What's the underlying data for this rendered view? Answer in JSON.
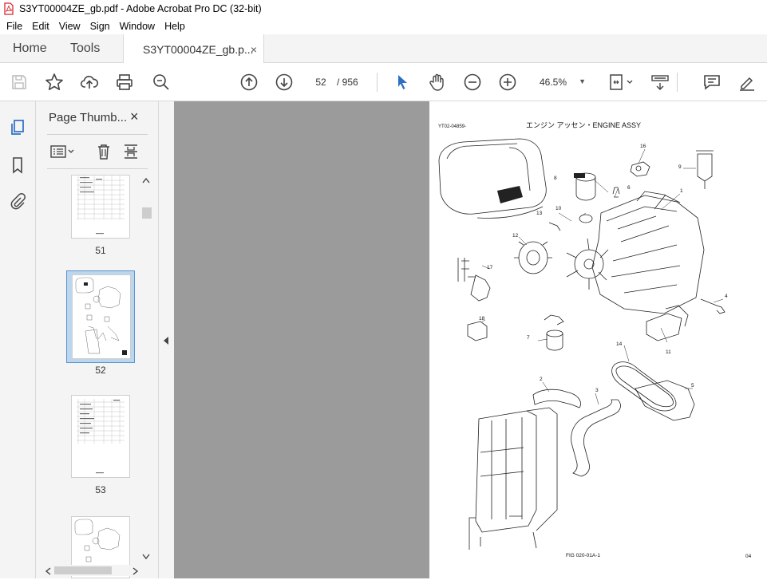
{
  "window": {
    "title": "S3YT00004ZE_gb.pdf - Adobe Acrobat Pro DC (32-bit)"
  },
  "menu": [
    "File",
    "Edit",
    "View",
    "Sign",
    "Window",
    "Help"
  ],
  "tabs": {
    "home": "Home",
    "tools": "Tools",
    "document": "S3YT00004ZE_gb.p...",
    "close": "×"
  },
  "toolbar": {
    "page_current": "52",
    "page_total": "/ 956",
    "zoom": "46.5%"
  },
  "panel": {
    "title": "Page Thumb...",
    "close": "×",
    "thumbnails": [
      {
        "label": "51"
      },
      {
        "label": "52"
      },
      {
        "label": "53"
      }
    ]
  },
  "document_page": {
    "title": "エンジン アッセン・ENGINE ASSY",
    "code": "YT02-04859-",
    "figure": "FIG 020-01A-1",
    "page_no": "04",
    "callouts": [
      "1",
      "2",
      "3",
      "4",
      "5",
      "6",
      "7",
      "8",
      "9",
      "10",
      "11",
      "12",
      "13",
      "14",
      "16",
      "17",
      "18"
    ]
  },
  "colors": {
    "accent": "#2b6fc4",
    "pdf_red": "#d7282f",
    "gray_viewer": "#9b9b9b"
  }
}
